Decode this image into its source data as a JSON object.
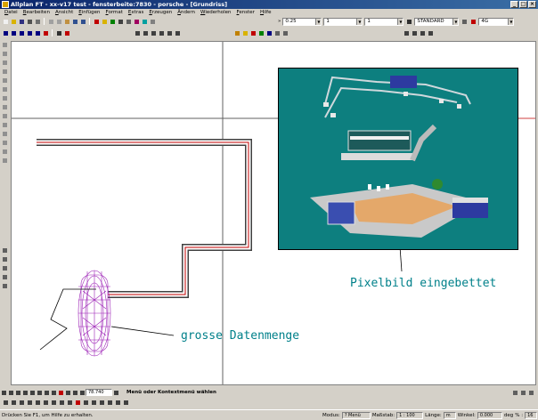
{
  "window": {
    "title": "Allplan FT - xx-v17 test - fensterbeite:7830 - porsche - [Grundriss]",
    "controls": [
      "_",
      "□",
      "×"
    ]
  },
  "menu": [
    "Datei",
    "Bearbeiten",
    "Ansicht",
    "Einfügen",
    "Format",
    "Extras",
    "Erzeugen",
    "Ändern",
    "Wiederholen",
    "Fenster",
    "Hilfe"
  ],
  "properties": {
    "pen": "0.25",
    "line": "1",
    "color": "1",
    "layer": "STANDARD",
    "layer_code": "4G"
  },
  "drawing": {
    "annotation_image": "Pixelbild eingebettet",
    "annotation_data": "grosse Datenmenge"
  },
  "bottom": {
    "coord_value": "78.740",
    "hint": "Menü oder Kontextmenü wählen"
  },
  "status": {
    "help": "Drücken Sie F1, um Hilfe zu erhalten.",
    "mode_label": "Modus:",
    "mode_value": "? Menü",
    "scale_label": "Maßstab:",
    "scale_value": "1 : 100",
    "length_label": "Länge:",
    "length_value": "m",
    "angle_label": "Winkel:",
    "angle_value": "0.000",
    "unit_label": "deg",
    "percent_label": "% :",
    "percent_value": "16"
  },
  "colors": {
    "annotation": "#00808a",
    "image_bg": "#0d7f7f",
    "wall": "#c00000",
    "car": "#9b1fb5"
  }
}
